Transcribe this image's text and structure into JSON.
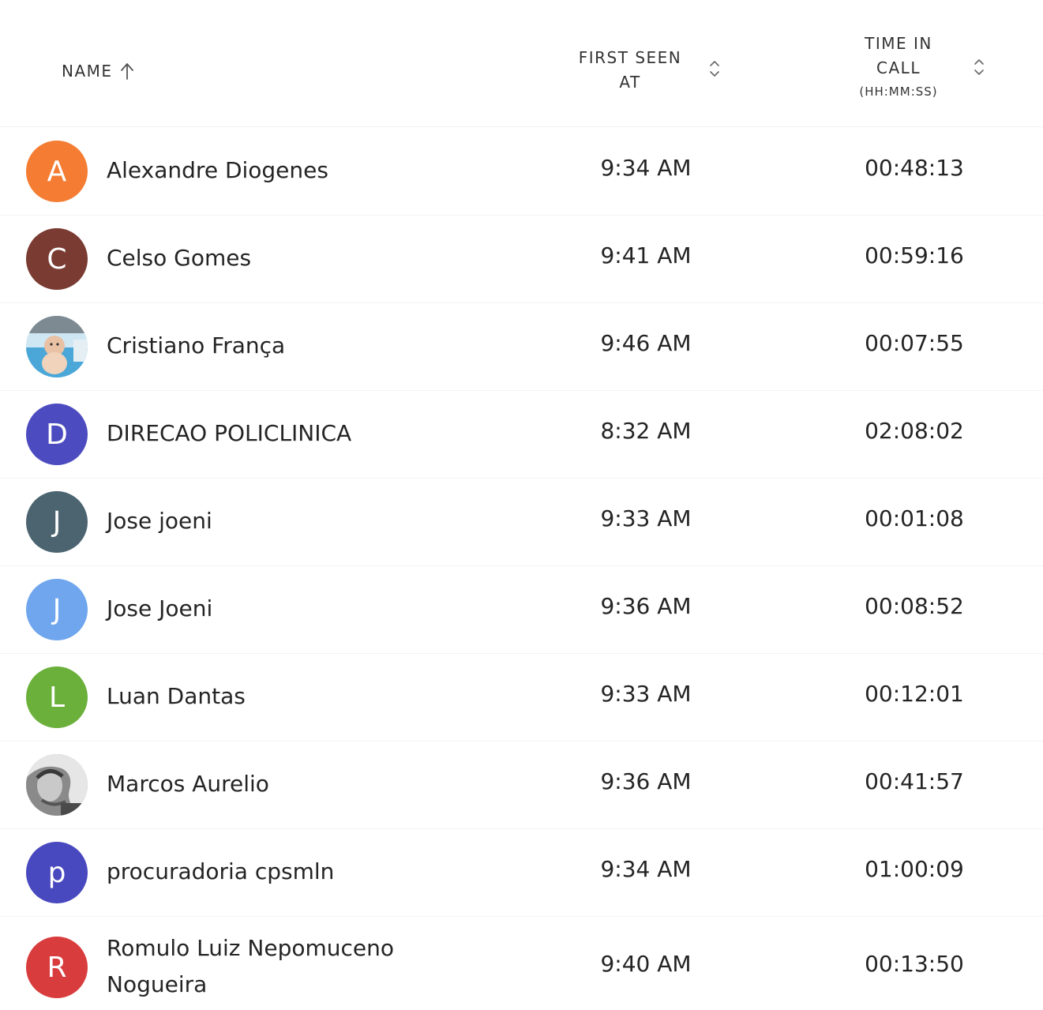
{
  "columns": {
    "name": "NAME",
    "first_seen": [
      "FIRST SEEN",
      "AT"
    ],
    "time_in_call": [
      "TIME IN",
      "CALL"
    ],
    "time_in_call_unit": "(HH:MM:SS)"
  },
  "sort": {
    "column": "name",
    "direction": "ascending"
  },
  "rows": [
    {
      "avatar_letter": "A",
      "avatar_color": "#f47c33",
      "avatar_type": "letter",
      "name": "Alexandre Diogenes",
      "first_seen": "9:34 AM",
      "time_in_call": "00:48:13"
    },
    {
      "avatar_letter": "C",
      "avatar_color": "#7a3b32",
      "avatar_type": "letter",
      "name": "Celso Gomes",
      "first_seen": "9:41 AM",
      "time_in_call": "00:59:16"
    },
    {
      "avatar_letter": "",
      "avatar_color": "#9fc9e6",
      "avatar_type": "photo",
      "name": "Cristiano França",
      "first_seen": "9:46 AM",
      "time_in_call": "00:07:55"
    },
    {
      "avatar_letter": "D",
      "avatar_color": "#4c4cc0",
      "avatar_type": "letter",
      "name": "DIRECAO POLICLINICA",
      "first_seen": "8:32 AM",
      "time_in_call": "02:08:02"
    },
    {
      "avatar_letter": "J",
      "avatar_color": "#4b6470",
      "avatar_type": "letter",
      "name": "Jose joeni",
      "first_seen": "9:33 AM",
      "time_in_call": "00:01:08"
    },
    {
      "avatar_letter": "J",
      "avatar_color": "#6fa6ee",
      "avatar_type": "letter",
      "name": "Jose Joeni",
      "first_seen": "9:36 AM",
      "time_in_call": "00:08:52"
    },
    {
      "avatar_letter": "L",
      "avatar_color": "#6ab03a",
      "avatar_type": "letter",
      "name": "Luan Dantas",
      "first_seen": "9:33 AM",
      "time_in_call": "00:12:01"
    },
    {
      "avatar_letter": "",
      "avatar_color": "#9a9a9a",
      "avatar_type": "photo",
      "name": "Marcos Aurelio",
      "first_seen": "9:36 AM",
      "time_in_call": "00:41:57"
    },
    {
      "avatar_letter": "p",
      "avatar_color": "#4848bf",
      "avatar_type": "letter",
      "name": "procuradoria cpsmln",
      "first_seen": "9:34 AM",
      "time_in_call": "01:00:09"
    },
    {
      "avatar_letter": "R",
      "avatar_color": "#d93c3c",
      "avatar_type": "letter",
      "name": "Romulo Luiz Nepomuceno Nogueira",
      "first_seen": "9:40 AM",
      "time_in_call": "00:13:50"
    }
  ],
  "icons": {
    "name_sort": "arrow-up-icon",
    "first_seen_sort": "sort-updown-icon",
    "time_sort": "sort-updown-icon",
    "photo_avatar": "photo-avatar-icon"
  }
}
